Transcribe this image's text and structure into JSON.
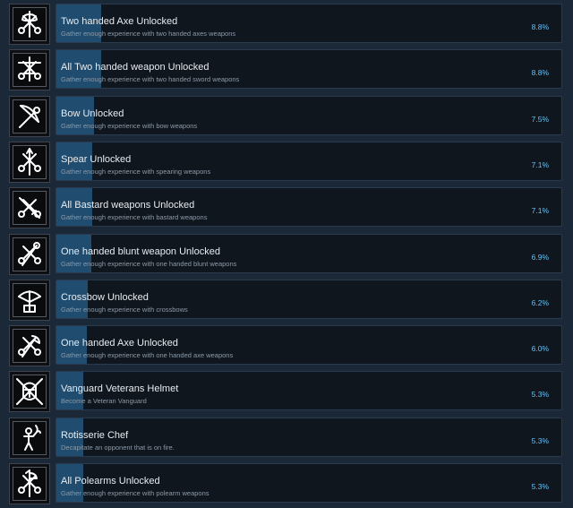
{
  "achievements": [
    {
      "title": "Two handed Axe Unlocked",
      "description": "Gather enough experience with two handed axes weapons",
      "percent": "8.8%",
      "progress_pct": 8.8,
      "icon": "two-handed-axe-icon"
    },
    {
      "title": "All Two handed weapon Unlocked",
      "description": "Gather enough experience with two handed sword weapons",
      "percent": "8.8%",
      "progress_pct": 8.8,
      "icon": "two-handed-sword-icon"
    },
    {
      "title": "Bow Unlocked",
      "description": "Gather enough experience with bow weapons",
      "percent": "7.5%",
      "progress_pct": 7.5,
      "icon": "bow-icon"
    },
    {
      "title": "Spear Unlocked",
      "description": "Gather enough experience with spearing weapons",
      "percent": "7.1%",
      "progress_pct": 7.1,
      "icon": "spear-icon"
    },
    {
      "title": "All Bastard weapons Unlocked",
      "description": "Gather enough experience with bastard weapons",
      "percent": "7.1%",
      "progress_pct": 7.1,
      "icon": "bastard-sword-icon"
    },
    {
      "title": "One handed blunt weapon Unlocked",
      "description": "Gather enough experience with one handed blunt weapons",
      "percent": "6.9%",
      "progress_pct": 6.9,
      "icon": "mace-icon"
    },
    {
      "title": "Crossbow Unlocked",
      "description": "Gather enough experience with crossbows",
      "percent": "6.2%",
      "progress_pct": 6.2,
      "icon": "crossbow-icon"
    },
    {
      "title": "One handed Axe Unlocked",
      "description": "Gather enough experience with one handed axe weapons",
      "percent": "6.0%",
      "progress_pct": 6.0,
      "icon": "one-handed-axe-icon"
    },
    {
      "title": "Vanguard Veterans Helmet",
      "description": "Become a Veteran Vanguard",
      "percent": "5.3%",
      "progress_pct": 5.3,
      "icon": "helmet-icon"
    },
    {
      "title": "Rotisserie Chef",
      "description": "Decapitate an opponent that is on fire.",
      "percent": "5.3%",
      "progress_pct": 5.3,
      "icon": "burning-knight-icon"
    },
    {
      "title": "All Polearms Unlocked",
      "description": "Gather enough experience with polearm weapons",
      "percent": "5.3%",
      "progress_pct": 5.3,
      "icon": "polearm-icon"
    }
  ]
}
